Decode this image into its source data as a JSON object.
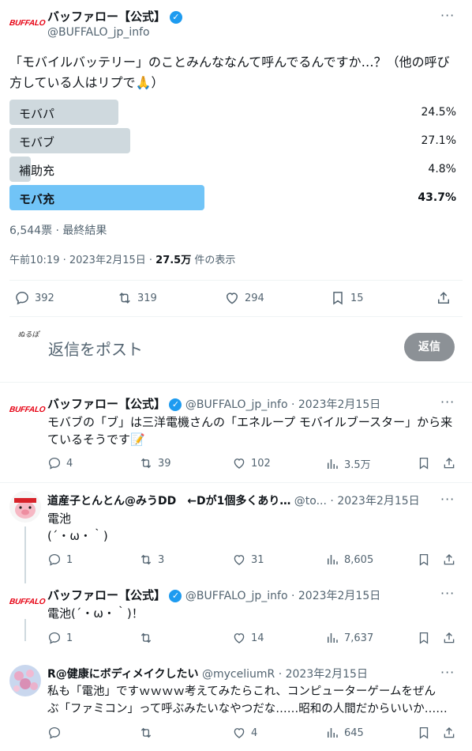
{
  "main_tweet": {
    "author_name": "バッファロー【公式】",
    "author_handle": "@BUFFALO_jp_info",
    "logo_text": "BUFFALO",
    "text": "「モバイルバッテリー」のことみんななんて呼んでるんですか…？（他の呼び方している人はリプで🙏）",
    "poll": {
      "options": [
        {
          "label": "モバパ",
          "percent": "24.5%",
          "value": 24.5,
          "winner": false
        },
        {
          "label": "モバブ",
          "percent": "27.1%",
          "value": 27.1,
          "winner": false
        },
        {
          "label": "補助充",
          "percent": "4.8%",
          "value": 4.8,
          "winner": false
        },
        {
          "label": "モバ充",
          "percent": "43.7%",
          "value": 43.7,
          "winner": true
        }
      ],
      "summary": "6,544票 · 最終結果"
    },
    "timestamp": "午前10:19 · 2023年2月15日 · ",
    "views": "27.5万",
    "views_suffix": " 件の表示",
    "replies": "392",
    "retweets": "319",
    "likes": "294",
    "bookmarks": "15"
  },
  "reply_box": {
    "avatar_text": "ぬるぽ",
    "placeholder": "返信をポスト",
    "button": "返信"
  },
  "replies": [
    {
      "author_name": "バッファロー【公式】",
      "author_handle": "@BUFFALO_jp_info",
      "date": "· 2023年2月15日",
      "text": "モバブの「ブ」は三洋電機さんの「エネループ モバイルブースター」から来ているそうです📝",
      "replies": "4",
      "retweets": "39",
      "likes": "102",
      "views": "3.5万"
    },
    {
      "author_name": "道産子とんとん@みうDD　←Dが1個多くあり…",
      "author_handle": "@to...",
      "date": "· 2023年2月15日",
      "text_line1": "電池",
      "text_line2": "(´・ω・｀)",
      "replies": "1",
      "retweets": "3",
      "likes": "31",
      "views": "8,605"
    },
    {
      "author_name": "バッファロー【公式】",
      "author_handle": "@BUFFALO_jp_info",
      "date": "· 2023年2月15日",
      "text": "電池(´・ω・｀)！",
      "replies": "1",
      "retweets": "",
      "likes": "14",
      "views": "7,637"
    },
    {
      "author_name": "R@健康にボディメイクしたい",
      "author_handle": "@myceliumR",
      "date": "· 2023年2月15日",
      "text_line1": "私も「電池」ですｗｗｗｗ考えてみたらこれ、コンピューターゲームをぜん",
      "text_line2": "ぶ「ファミコン」って呼ぶみたいなやつだな……昭和の人間だからいいか……",
      "replies": "",
      "retweets": "",
      "likes": "4",
      "views": "645"
    }
  ],
  "colors": {
    "accent": "#1d9bf0",
    "poll_bar": "#cfd9de",
    "poll_winner": "#71c4f7",
    "brand_red": "#e60012"
  }
}
